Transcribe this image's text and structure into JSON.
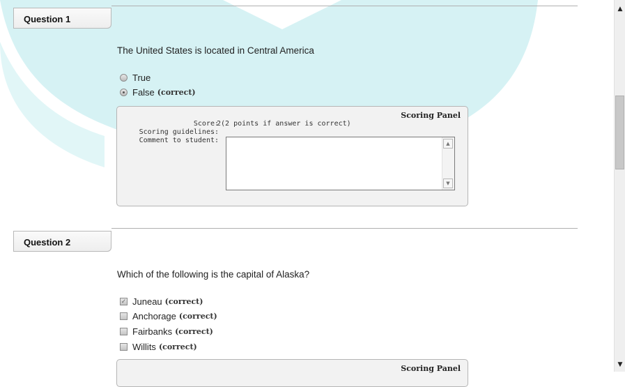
{
  "questions": [
    {
      "header": "Question 1",
      "text": "The United States is located in Central America",
      "options": [
        {
          "label": "True",
          "correct_tag": ""
        },
        {
          "label": "False",
          "correct_tag": "(correct)"
        }
      ],
      "panel": {
        "title": "Scoring Panel",
        "score_label": "Score:",
        "score_value": "2(2 points if answer is correct)",
        "guidelines_label": "Scoring guidelines:",
        "comment_label": "Comment to student:",
        "comment_value": ""
      }
    },
    {
      "header": "Question 2",
      "text": "Which of the following is the capital of Alaska?",
      "options": [
        {
          "label": "Juneau",
          "correct_tag": "(correct)",
          "checked": true
        },
        {
          "label": "Anchorage",
          "correct_tag": "(correct)",
          "checked": false
        },
        {
          "label": "Fairbanks",
          "correct_tag": "(correct)",
          "checked": false
        },
        {
          "label": "Willits",
          "correct_tag": "(correct)",
          "checked": false
        }
      ],
      "panel": {
        "title": "Scoring Panel"
      }
    }
  ],
  "colors": {
    "watermark": "#c8eef0",
    "panel_bg": "#f2f2f2",
    "border": "#b0b0b0"
  },
  "icons": {
    "scroll_up": "▲",
    "scroll_down": "▼",
    "check": "✓"
  }
}
